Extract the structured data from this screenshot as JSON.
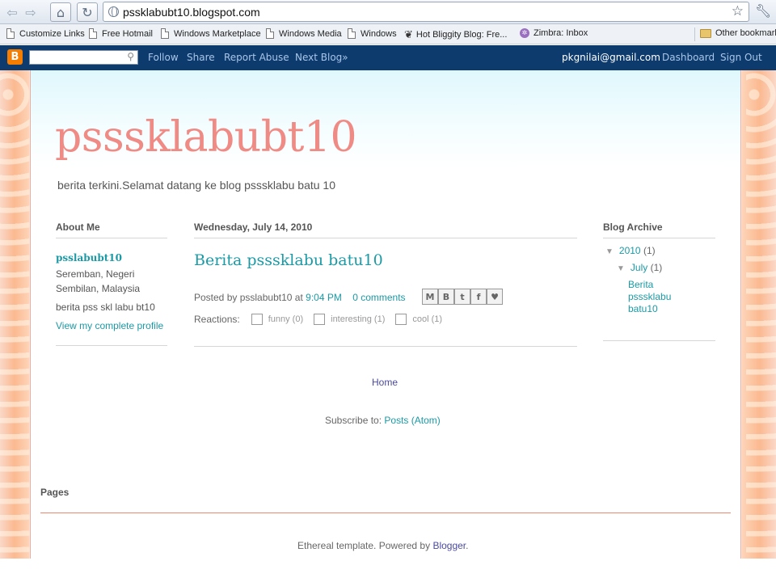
{
  "browser": {
    "url": "pssklabubt10.blogspot.com",
    "bookmarks": [
      {
        "label": "Customize Links",
        "icon": "page-icon"
      },
      {
        "label": "Free Hotmail",
        "icon": "page-icon"
      },
      {
        "label": "Windows Marketplace",
        "icon": "page-icon"
      },
      {
        "label": "Windows Media",
        "icon": "page-icon"
      },
      {
        "label": "Windows",
        "icon": "page-icon"
      },
      {
        "label": "Hot Bliggity Blog: Fre...",
        "icon": "wheat-icon"
      },
      {
        "label": "Zimbra: Inbox",
        "icon": "zimbra-icon"
      },
      {
        "label": "Other bookmarks",
        "icon": "folder-icon"
      }
    ]
  },
  "navbar": {
    "logo": "B",
    "links": [
      "Follow",
      "Share",
      "Report Abuse",
      "Next Blog»"
    ],
    "email": "pkgnilai@gmail.com",
    "dashboard": "Dashboard",
    "signout": "Sign Out"
  },
  "blog": {
    "title": "psssklabubt10",
    "description": "berita terkini.Selamat datang ke blog psssklabu batu 10"
  },
  "about": {
    "heading": "About Me",
    "name": "psslabubt10",
    "location": "Seremban, Negeri Sembilan, Malaysia",
    "about": "berita pss skl labu bt10",
    "profile_link": "View my complete profile"
  },
  "post": {
    "date": "Wednesday, July 14, 2010",
    "title": "Berita psssklabu batu10",
    "posted_by_prefix": "Posted by",
    "author": "psslabubt10",
    "at": "at",
    "time": "9:04 PM",
    "comments": "0 comments",
    "share_icons": [
      "M",
      "B",
      "t",
      "f",
      "♥"
    ],
    "reactions_label": "Reactions:",
    "reactions": [
      {
        "label": "funny (0)"
      },
      {
        "label": "interesting (1)"
      },
      {
        "label": "cool (1)"
      }
    ]
  },
  "archive": {
    "heading": "Blog Archive",
    "year": "2010",
    "year_count": "(1)",
    "month": "July",
    "month_count": "(1)",
    "post_title": "Berita psssklabu batu10"
  },
  "home_link": "Home",
  "subscribe": {
    "prefix": "Subscribe to:",
    "link": "Posts (Atom)"
  },
  "pages_heading": "Pages",
  "footer": {
    "text": "Ethereal template. Powered by",
    "link": "Blogger",
    "suffix": "."
  }
}
